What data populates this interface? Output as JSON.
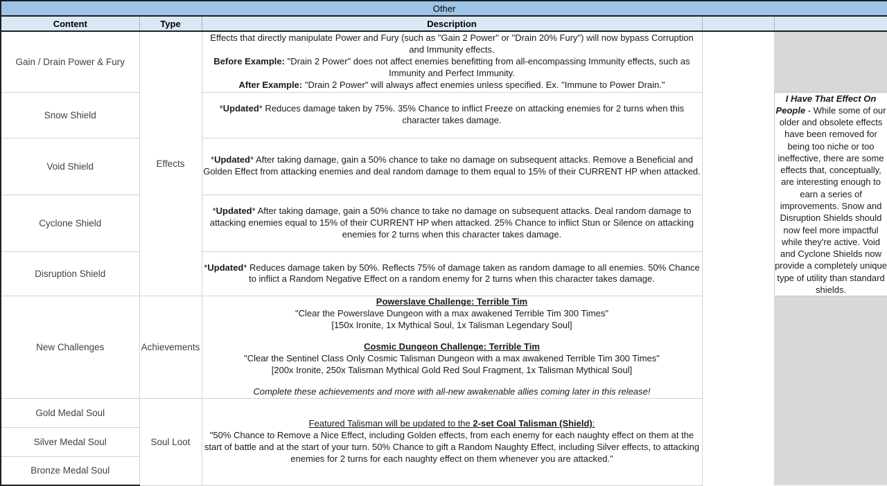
{
  "title": "Other",
  "columns": {
    "content": "Content",
    "type": "Type",
    "description": "Description",
    "blank1": "",
    "blank2": ""
  },
  "rows": [
    {
      "content": "Gain / Drain Power & Fury",
      "type": "Effects",
      "description_plain": "Effects that directly manipulate Power and Fury (such as \"Gain 2 Power\" or \"Drain 20% Fury\") will now bypass Corruption and Immunity effects. Before Example: \"Drain 2 Power\" does not affect enemies benefitting from all-encompassing Immunity effects, such as Immunity and Perfect Immunity. After Example: \"Drain 2 Power\" will always affect enemies unless specified. Ex. \"Immune to Power Drain.\"",
      "description_parts": [
        {
          "text": "Effects that directly manipulate Power and Fury (such as \"Gain 2 Power\" or \"Drain 20% Fury\") will now bypass Corruption and Immunity effects.",
          "style": "normal",
          "break_after": true
        },
        {
          "text": "Before Example:",
          "style": "bold"
        },
        {
          "text": " \"Drain 2 Power\" does not affect enemies benefitting from all-encompassing Immunity effects, such as Immunity and Perfect Immunity.",
          "style": "normal",
          "break_after": true
        },
        {
          "text": "After Example:",
          "style": "bold"
        },
        {
          "text": " \"Drain 2 Power\" will always affect enemies unless specified. Ex. \"Immune to Power Drain.\"",
          "style": "normal"
        }
      ]
    },
    {
      "content": "Snow Shield",
      "type": "",
      "description_plain": "*Updated* Reduces damage taken by 75%. 35% Chance to inflict Freeze on attacking enemies for 2 turns when this character takes damage.",
      "description_parts": [
        {
          "text": "*",
          "style": "normal"
        },
        {
          "text": "Updated",
          "style": "bold"
        },
        {
          "text": "* Reduces damage taken by 75%. 35% Chance to inflict Freeze on attacking enemies for 2 turns when this character takes damage.",
          "style": "normal"
        }
      ]
    },
    {
      "content": "Void Shield",
      "type": "",
      "description_plain": "*Updated* After taking damage, gain a 50% chance to take no damage on subsequent attacks. Remove a Beneficial and Golden Effect from attacking enemies and deal random damage to them equal to 15% of their CURRENT HP when attacked.",
      "description_parts": [
        {
          "text": "*",
          "style": "normal"
        },
        {
          "text": "Updated",
          "style": "bold"
        },
        {
          "text": "* After taking damage, gain a 50% chance to take no damage on subsequent attacks. Remove a Beneficial and Golden Effect from attacking enemies and deal random damage to them equal to 15% of their CURRENT HP when attacked.",
          "style": "normal"
        }
      ]
    },
    {
      "content": "Cyclone Shield",
      "type": "",
      "description_plain": "*Updated* After taking damage, gain a 50% chance to take no damage on subsequent attacks. Deal random damage to attacking enemies equal to 15% of their CURRENT HP when attacked. 25% Chance to inflict Stun or Silence on attacking enemies for 2 turns when this character takes damage.",
      "description_parts": [
        {
          "text": "*",
          "style": "normal"
        },
        {
          "text": "Updated",
          "style": "bold"
        },
        {
          "text": "* After taking damage, gain a 50% chance to take no damage on subsequent attacks. Deal random damage to attacking enemies equal to 15% of their CURRENT HP when attacked. 25% Chance to inflict Stun or Silence on attacking enemies for 2 turns when this character takes damage.",
          "style": "normal"
        }
      ]
    },
    {
      "content": "Disruption Shield",
      "type": "",
      "description_plain": "*Updated* Reduces damage taken by 50%. Reflects 75% of damage taken as random damage to all enemies. 50% Chance to inflict a Random Negative Effect on a random enemy for 2 turns when this character takes damage.",
      "description_parts": [
        {
          "text": "*",
          "style": "normal"
        },
        {
          "text": "Updated",
          "style": "bold"
        },
        {
          "text": "* Reduces damage taken by 50%. Reflects 75% of damage taken as random damage to all enemies. 50% Chance to inflict a Random Negative Effect on a random enemy for 2 turns when this character takes damage.",
          "style": "normal"
        }
      ]
    },
    {
      "content": "New Challenges",
      "type": "Achievements",
      "description_plain": "Powerslave Challenge: Terrible Tim \"Clear the Powerslave Dungeon with a max awakened Terrible Tim 300 Times\" [150x Ironite, 1x Mythical Soul, 1x Talisman Legendary Soul] Cosmic Dungeon Challenge: Terrible Tim \"Clear the Sentinel Class Only Cosmic Talisman Dungeon with a max awakened Terrible Tim 300 Times\" [200x Ironite, 250x Talisman Mythical Gold Red Soul Fragment, 1x Talisman Mythical Soul] Complete these achievements and more with all-new awakenable allies coming later in this release!",
      "description_parts": [
        {
          "text": "Powerslave Challenge: Terrible Tim",
          "style": "bold-underline",
          "break_after": true
        },
        {
          "text": "\"Clear the Powerslave Dungeon with a max awakened Terrible Tim 300 Times\"",
          "style": "normal",
          "break_after": true
        },
        {
          "text": "[150x Ironite, 1x Mythical Soul, 1x Talisman Legendary Soul]",
          "style": "normal",
          "break_after": true
        },
        {
          "text": "",
          "style": "gap"
        },
        {
          "text": "Cosmic Dungeon Challenge: Terrible Tim",
          "style": "bold-underline",
          "break_after": true
        },
        {
          "text": "\"Clear the Sentinel Class Only Cosmic Talisman Dungeon with a max awakened Terrible Tim 300 Times\"",
          "style": "normal",
          "break_after": true
        },
        {
          "text": "[200x Ironite, 250x Talisman Mythical Gold Red Soul Fragment, 1x Talisman Mythical Soul]",
          "style": "normal",
          "break_after": true
        },
        {
          "text": "",
          "style": "gap"
        },
        {
          "text": "Complete these achievements and more with all-new awakenable allies coming later in this release!",
          "style": "italic"
        }
      ]
    },
    {
      "content": "Gold Medal Soul",
      "type": "Soul Loot",
      "description_plain": "Featured Talisman will be updated to the 2-set Coal Talisman (Shield): \"50% Chance to Remove a Nice Effect, including Golden effects, from each enemy for each naughty effect on them at the start of battle and at the start of your turn. 50% Chance to gift a Random Naughty Effect, including Silver effects, to attacking enemies for 2 turns for each naughty effect on them whenever you are attacked.\"",
      "description_parts": [
        {
          "text": "Featured Talisman will be updated to the ",
          "style": "underline"
        },
        {
          "text": "2-set Coal Talisman (Shield)",
          "style": "bold-underline"
        },
        {
          "text": ":",
          "style": "underline",
          "break_after": true
        },
        {
          "text": "\"50% Chance to Remove a Nice Effect, including Golden effects, from each enemy for each naughty effect on them at the start of battle and at the start of your turn. 50% Chance to gift a Random Naughty Effect, including Silver effects, to attacking enemies for 2 turns for each naughty effect on them whenever you are attacked.\"",
          "style": "normal"
        }
      ]
    },
    {
      "content": "Silver Medal Soul",
      "type": "",
      "description_plain": "",
      "description_parts": []
    },
    {
      "content": "Bronze Medal Soul",
      "type": "",
      "description_plain": "",
      "description_parts": []
    }
  ],
  "note": {
    "heading": "I Have That Effect On People",
    "separator": " - ",
    "body": "While some of our older and obsolete effects have been removed for being too niche or too ineffective, there are some effects that, conceptually, are interesting enough to earn a series of improvements. Snow and Disruption Shields should now feel more impactful while they're active. Void and Cyclone Shields now provide a completely unique type of utility than standard shields."
  },
  "colors": {
    "title_band": "#9DC3E6",
    "header_band": "#DAE8F5",
    "gray_fill": "#D8D8D8",
    "grid_line": "#D3D3D3",
    "outer_border": "#1F1F1F",
    "left_text": "#38424E"
  }
}
